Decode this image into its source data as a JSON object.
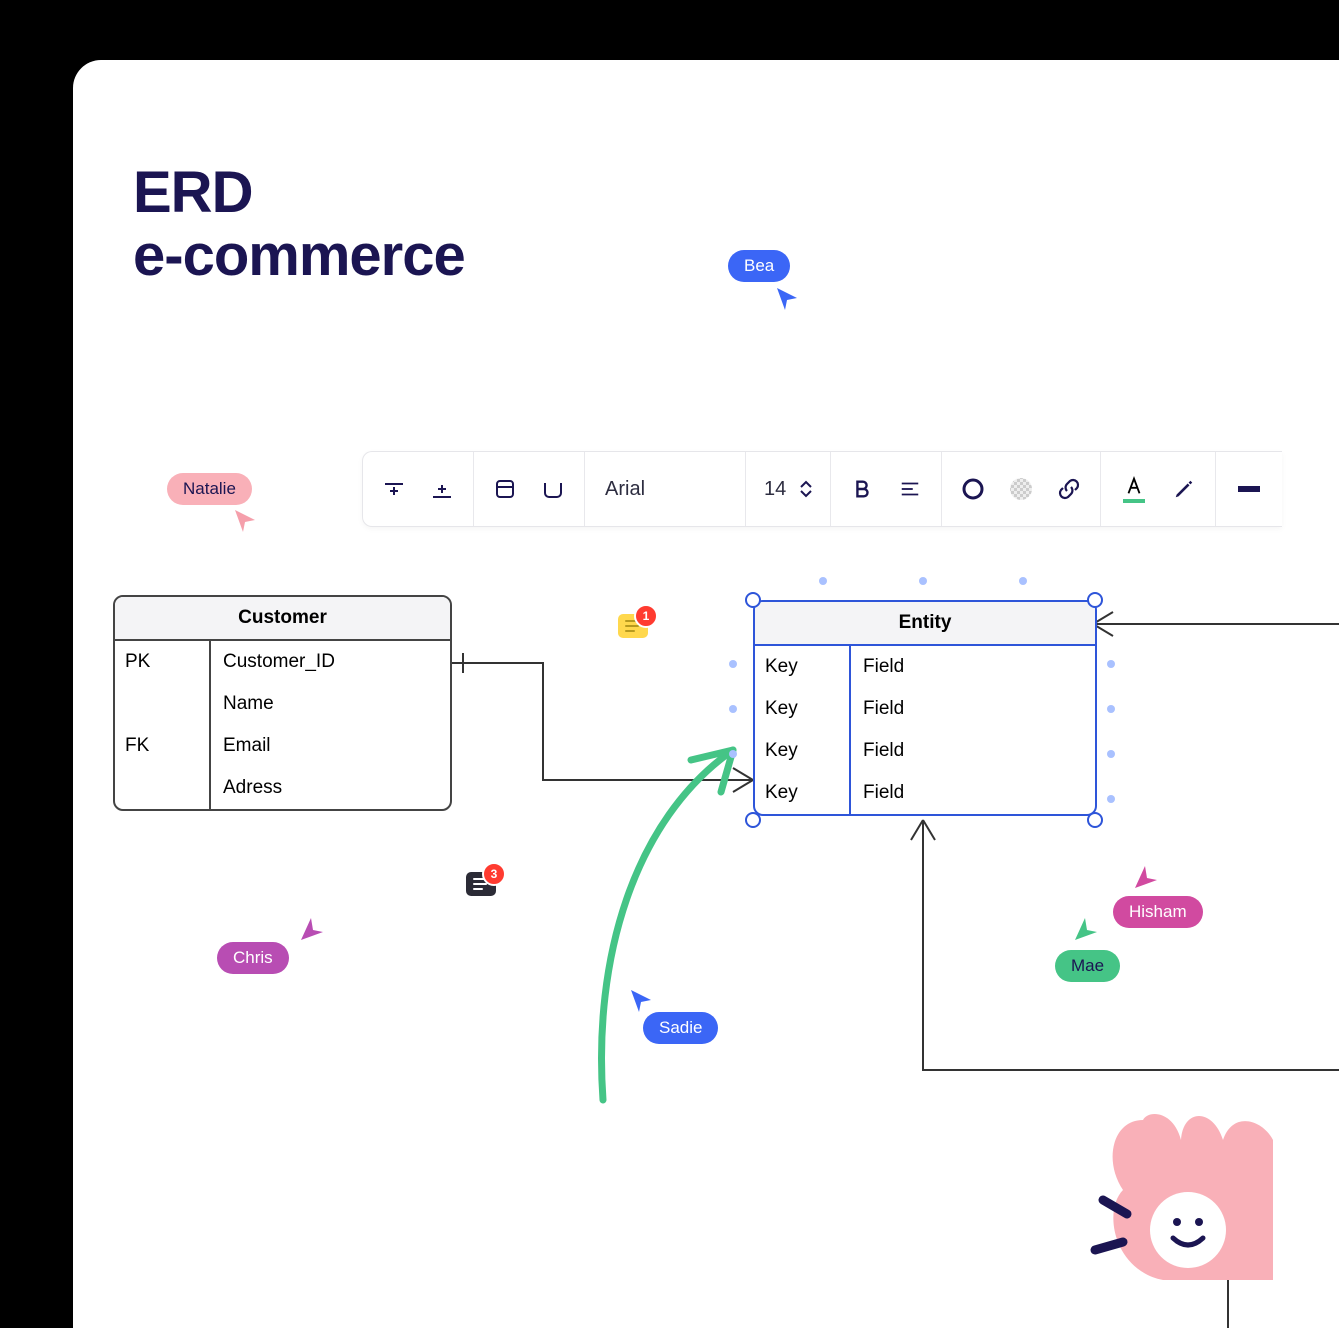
{
  "title": "ERD\ne-commerce",
  "toolbar": {
    "font_name": "Arial",
    "font_size": "14"
  },
  "tables": {
    "customer": {
      "name": "Customer",
      "rows": [
        {
          "key": "PK",
          "field": "Customer_ID"
        },
        {
          "key": "",
          "field": "Name"
        },
        {
          "key": "FK",
          "field": "Email"
        },
        {
          "key": "",
          "field": "Adress"
        }
      ]
    },
    "entity": {
      "name": "Entity",
      "rows": [
        {
          "key": "Key",
          "field": "Field"
        },
        {
          "key": "Key",
          "field": "Field"
        },
        {
          "key": "Key",
          "field": "Field"
        },
        {
          "key": "Key",
          "field": "Field"
        }
      ]
    }
  },
  "cursors": {
    "natalie": {
      "label": "Natalie",
      "color": "#f9b0b8",
      "text": "#1b1552"
    },
    "bea": {
      "label": "Bea",
      "color": "#3b66f6",
      "text": "#ffffff"
    },
    "chris": {
      "label": "Chris",
      "color": "#b84db3",
      "text": "#ffffff"
    },
    "sadie": {
      "label": "Sadie",
      "color": "#3b66f6",
      "text": "#ffffff"
    },
    "mae": {
      "label": "Mae",
      "color": "#45c486",
      "text": "#1b1552"
    },
    "hisham": {
      "label": "Hisham",
      "color": "#d14aa0",
      "text": "#ffffff"
    }
  },
  "comments": {
    "yellow_count": "1",
    "dark_count": "3"
  },
  "colors": {
    "text_color_accent": "#45c486",
    "stroke_color": "#1b1552"
  }
}
